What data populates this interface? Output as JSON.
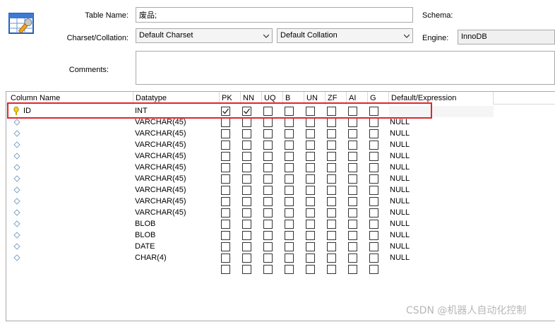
{
  "form": {
    "table_name_label": "Table Name:",
    "table_name_value": "废品;",
    "schema_label": "Schema:",
    "charset_label": "Charset/Collation:",
    "charset_value": "Default Charset",
    "collation_value": "Default Collation",
    "engine_label": "Engine:",
    "engine_value": "InnoDB",
    "comments_label": "Comments:",
    "comments_value": ""
  },
  "grid": {
    "headers": [
      "Column Name",
      "Datatype",
      "PK",
      "NN",
      "UQ",
      "B",
      "UN",
      "ZF",
      "AI",
      "G",
      "Default/Expression"
    ],
    "rows": [
      {
        "name": "ID",
        "type": "INT",
        "key": true,
        "flags": [
          true,
          true,
          false,
          false,
          false,
          false,
          false,
          false
        ],
        "default": ""
      },
      {
        "name": "",
        "type": "VARCHAR(45)",
        "key": false,
        "flags": [
          false,
          false,
          false,
          false,
          false,
          false,
          false,
          false
        ],
        "default": "NULL"
      },
      {
        "name": "",
        "type": "VARCHAR(45)",
        "key": false,
        "flags": [
          false,
          false,
          false,
          false,
          false,
          false,
          false,
          false
        ],
        "default": "NULL"
      },
      {
        "name": "",
        "type": "VARCHAR(45)",
        "key": false,
        "flags": [
          false,
          false,
          false,
          false,
          false,
          false,
          false,
          false
        ],
        "default": "NULL"
      },
      {
        "name": "",
        "type": "VARCHAR(45)",
        "key": false,
        "flags": [
          false,
          false,
          false,
          false,
          false,
          false,
          false,
          false
        ],
        "default": "NULL"
      },
      {
        "name": "",
        "type": "VARCHAR(45)",
        "key": false,
        "flags": [
          false,
          false,
          false,
          false,
          false,
          false,
          false,
          false
        ],
        "default": "NULL"
      },
      {
        "name": "",
        "type": "VARCHAR(45)",
        "key": false,
        "flags": [
          false,
          false,
          false,
          false,
          false,
          false,
          false,
          false
        ],
        "default": "NULL"
      },
      {
        "name": "",
        "type": "VARCHAR(45)",
        "key": false,
        "flags": [
          false,
          false,
          false,
          false,
          false,
          false,
          false,
          false
        ],
        "default": "NULL"
      },
      {
        "name": "",
        "type": "VARCHAR(45)",
        "key": false,
        "flags": [
          false,
          false,
          false,
          false,
          false,
          false,
          false,
          false
        ],
        "default": "NULL"
      },
      {
        "name": "",
        "type": "VARCHAR(45)",
        "key": false,
        "flags": [
          false,
          false,
          false,
          false,
          false,
          false,
          false,
          false
        ],
        "default": "NULL"
      },
      {
        "name": "",
        "type": "BLOB",
        "key": false,
        "flags": [
          false,
          false,
          false,
          false,
          false,
          false,
          false,
          false
        ],
        "default": "NULL"
      },
      {
        "name": "",
        "type": "BLOB",
        "key": false,
        "flags": [
          false,
          false,
          false,
          false,
          false,
          false,
          false,
          false
        ],
        "default": "NULL"
      },
      {
        "name": "",
        "type": "DATE",
        "key": false,
        "flags": [
          false,
          false,
          false,
          false,
          false,
          false,
          false,
          false
        ],
        "default": "NULL"
      },
      {
        "name": "",
        "type": "CHAR(4)",
        "key": false,
        "flags": [
          false,
          false,
          false,
          false,
          false,
          false,
          false,
          false
        ],
        "default": "NULL"
      }
    ]
  },
  "watermark": "CSDN @机器人自动化控制"
}
